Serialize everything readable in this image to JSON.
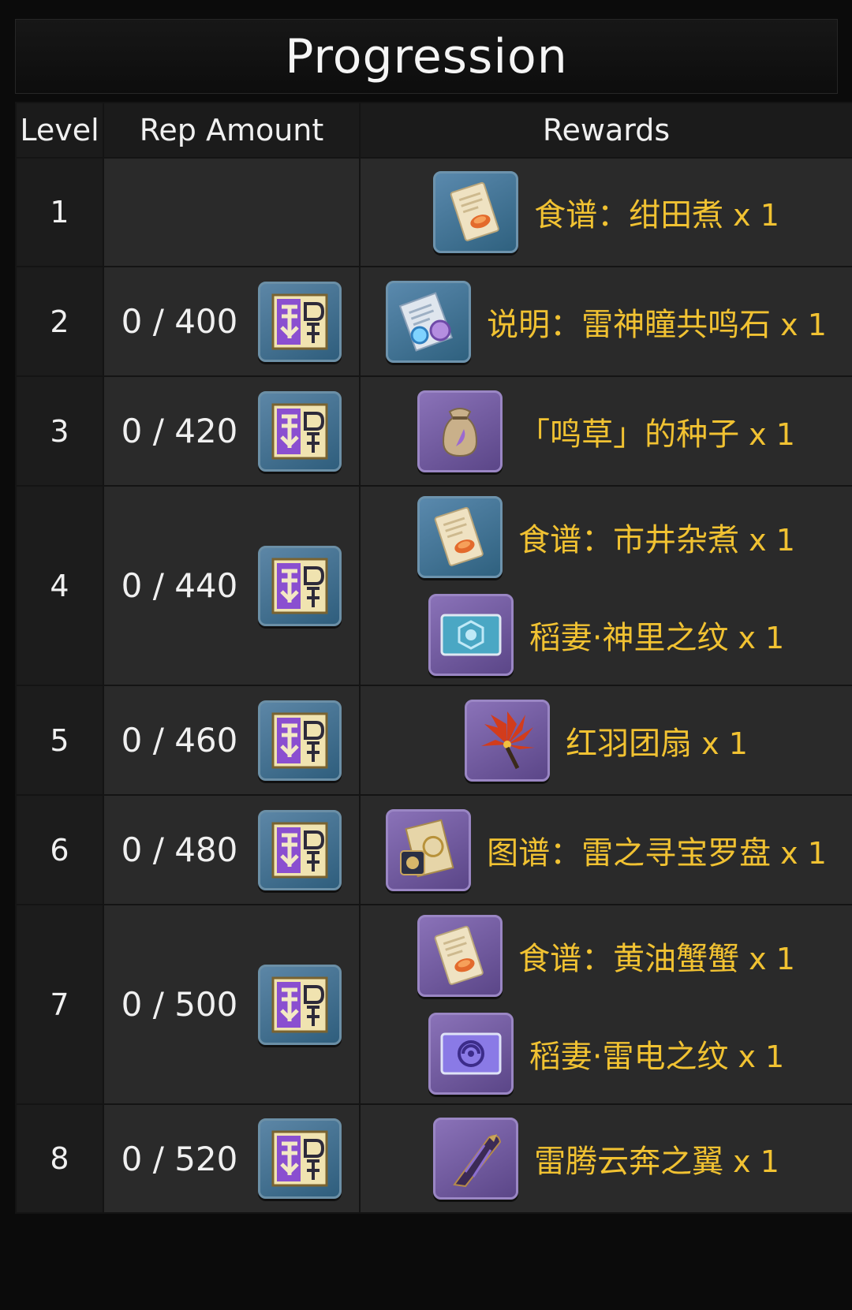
{
  "title": "Progression",
  "headers": {
    "level": "Level",
    "rep": "Rep Amount",
    "rewards": "Rewards"
  },
  "rows": [
    {
      "level": "1",
      "rep": "",
      "rewards": [
        {
          "name": "食谱：绀田煮",
          "qty": "x 1",
          "icon": "recipe-scroll-icon",
          "frame": "blue"
        }
      ]
    },
    {
      "level": "2",
      "rep": "0 / 400",
      "rewards": [
        {
          "name": "说明：雷神瞳共鸣石",
          "qty": "x 1",
          "icon": "instructions-paper-icon",
          "frame": "blue"
        }
      ]
    },
    {
      "level": "3",
      "rep": "0 / 420",
      "rewards": [
        {
          "name": "「鸣草」的种子",
          "qty": "x 1",
          "icon": "seed-bag-icon",
          "frame": "purple"
        }
      ]
    },
    {
      "level": "4",
      "rep": "0 / 440",
      "rewards": [
        {
          "name": "食谱：市井杂煮",
          "qty": "x 1",
          "icon": "recipe-scroll-icon",
          "frame": "blue"
        },
        {
          "name": "稻妻·神里之纹",
          "qty": "x 1",
          "icon": "namecard-kamisato-icon",
          "frame": "purple"
        }
      ]
    },
    {
      "level": "5",
      "rep": "0 / 460",
      "rewards": [
        {
          "name": "红羽团扇",
          "qty": "x 1",
          "icon": "red-feather-fan-icon",
          "frame": "purple"
        }
      ]
    },
    {
      "level": "6",
      "rep": "0 / 480",
      "rewards": [
        {
          "name": "图谱：雷之寻宝罗盘",
          "qty": "x 1",
          "icon": "diagram-compass-icon",
          "frame": "purple"
        }
      ]
    },
    {
      "level": "7",
      "rep": "0 / 500",
      "rewards": [
        {
          "name": "食谱：黄油蟹蟹",
          "qty": "x 1",
          "icon": "recipe-scroll-icon",
          "frame": "purple"
        },
        {
          "name": "稻妻·雷电之纹",
          "qty": "x 1",
          "icon": "namecard-raiden-icon",
          "frame": "purple"
        }
      ]
    },
    {
      "level": "8",
      "rep": "0 / 520",
      "rewards": [
        {
          "name": "雷腾云奔之翼",
          "qty": "x 1",
          "icon": "wings-glider-icon",
          "frame": "purple"
        }
      ]
    }
  ],
  "rep_icon": "inazuma-reputation-icon"
}
